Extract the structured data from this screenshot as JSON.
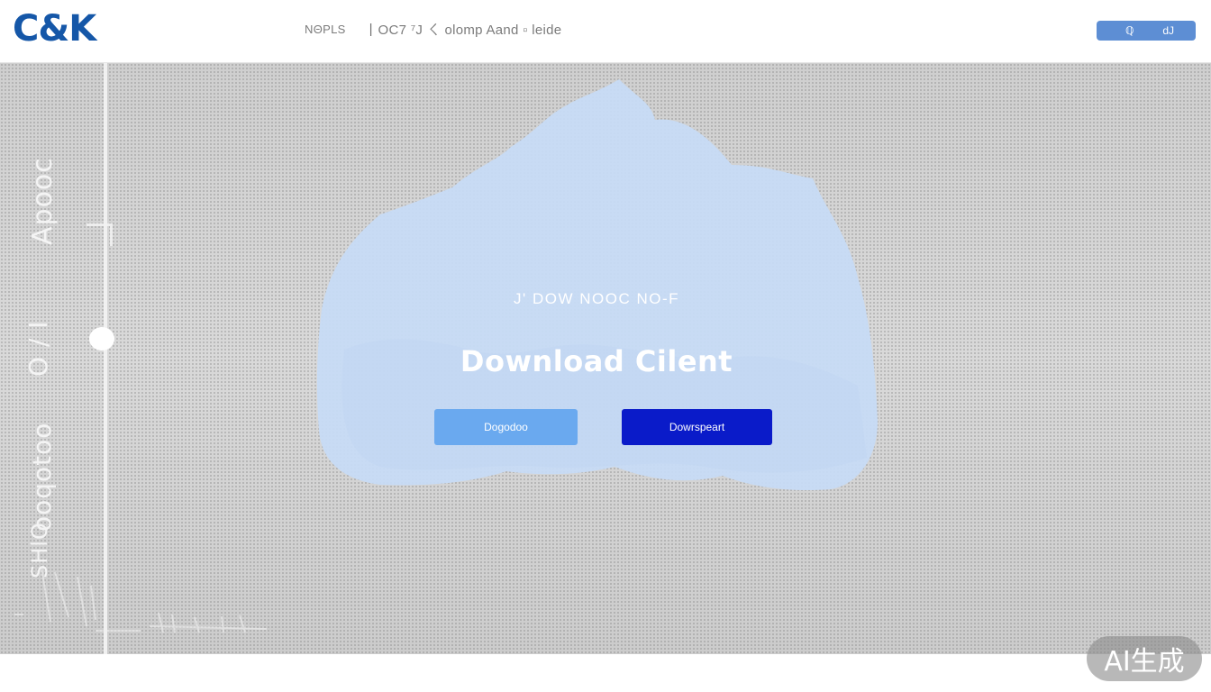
{
  "header": {
    "logo": "C&K",
    "nav": {
      "item1": "NΘPLS",
      "separator": "|",
      "item2": "OC7 ⁷J ㄑ olomp Aand ▫ leide"
    },
    "button": {
      "left_label": "ℚ",
      "right_label": "dJ"
    }
  },
  "sidebar": {
    "labels": [
      "Apooc",
      "O / I",
      "ooqotoo",
      "SHlO"
    ]
  },
  "hero": {
    "kicker": "J' DOW NOOC NO-F",
    "title": "Download Cilent",
    "buttons": {
      "secondary_label": "Dogodoo",
      "primary_label": "Dowrspeart"
    }
  },
  "watermark": "AI生成",
  "colors": {
    "brand": "#1557a8",
    "header_button": "#5d8ed4",
    "cloud": "#c9dbf4",
    "button_light": "#6aa9ef",
    "button_dark": "#0a1bc9"
  }
}
